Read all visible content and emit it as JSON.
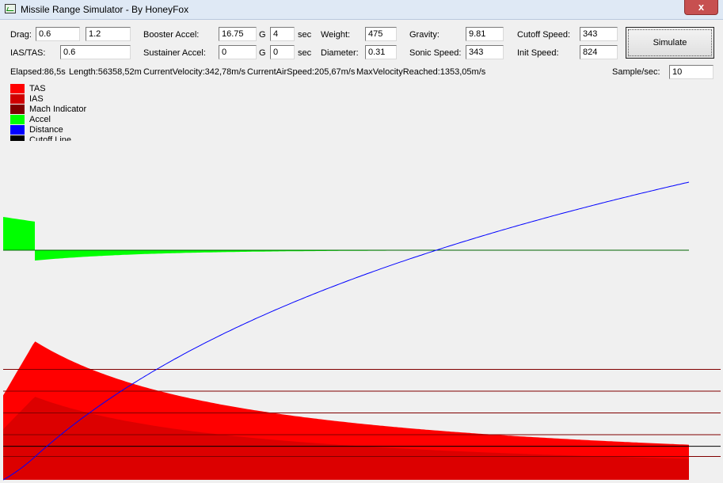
{
  "window": {
    "title": "Missile Range Simulator - By HoneyFox",
    "close_label": "x"
  },
  "params": {
    "drag_label": "Drag:",
    "drag1": "0.6",
    "drag2": "1.2",
    "ias_tas_label": "IAS/TAS:",
    "ias_tas": "0.6",
    "booster_label": "Booster Accel:",
    "booster_g": "16.75",
    "booster_g_unit": "G",
    "booster_sec": "4",
    "booster_sec_unit": "sec",
    "sustainer_label": "Sustainer Accel:",
    "sustainer_g": "0",
    "sustainer_g_unit": "G",
    "sustainer_sec": "0",
    "sustainer_sec_unit": "sec",
    "weight_label": "Weight:",
    "weight": "475",
    "diameter_label": "Diameter:",
    "diameter": "0.31",
    "gravity_label": "Gravity:",
    "gravity": "9.81",
    "sonic_label": "Sonic Speed:",
    "sonic": "343",
    "cutoff_label": "Cutoff Speed:",
    "cutoff": "343",
    "init_label": "Init Speed:",
    "init": "824",
    "simulate_label": "Simulate"
  },
  "status": {
    "elapsed": "Elapsed:86,5s",
    "length": "Length:56358,52m",
    "current_velocity": "CurrentVelocity:342,78m/s",
    "current_airspeed": "CurrentAirSpeed:205,67m/s",
    "max_velocity": "MaxVelocityReached:1353,05m/s",
    "sample_label": "Sample/sec:",
    "sample": "10"
  },
  "legend": [
    {
      "label": "TAS",
      "color": "#ff0000"
    },
    {
      "label": "IAS",
      "color": "#d00000"
    },
    {
      "label": "Mach Indicator",
      "color": "#800000"
    },
    {
      "label": "Accel",
      "color": "#00ff00"
    },
    {
      "label": "Distance",
      "color": "#0000ff"
    },
    {
      "label": "Cutoff Line",
      "color": "#000000"
    }
  ],
  "chart_data": {
    "type": "area",
    "x": {
      "start": 0,
      "end": 86.5,
      "unit": "s"
    },
    "booster_end": 4,
    "max_tas": 1353.05,
    "final_tas": 342.78,
    "final_ias": 205.67,
    "init_speed": 824,
    "final_distance": 56358.52,
    "cutoff_speed": 343,
    "sonic_speed": 343,
    "mach_lines": [
      1,
      2,
      3,
      4,
      5
    ],
    "accel_boost": 164.3,
    "accel_after_boost": -51,
    "colors": {
      "tas": "#ff0000",
      "ias": "#d00000",
      "mach": "#800000",
      "accel": "#00ff00",
      "distance": "#0000ff",
      "cutoff": "#000000",
      "zero": "#006400"
    }
  }
}
